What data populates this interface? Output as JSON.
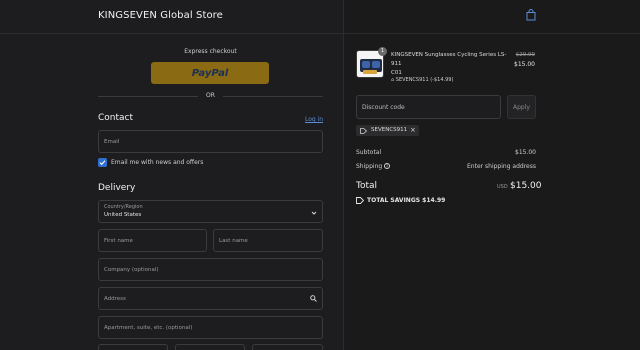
{
  "header": {
    "store_name": "KINGSEVEN Global Store",
    "cart_icon": "shopping-bag-icon"
  },
  "express": {
    "label": "Express checkout",
    "paypal_label": "PayPal",
    "or_label": "OR"
  },
  "contact": {
    "title": "Contact",
    "login_link": "Log in",
    "email_label": "Email",
    "newsletter_label": "Email me with news and offers",
    "newsletter_checked": true
  },
  "delivery": {
    "title": "Delivery",
    "country_label": "Country/Region",
    "country_value": "United States",
    "first_name_label": "First name",
    "last_name_label": "Last name",
    "company_label": "Company (optional)",
    "address_label": "Address",
    "apartment_label": "Apartment, suite, etc. (optional)"
  },
  "order": {
    "item": {
      "title": "KINGSEVEN Sunglasses Cycling Series LS-911",
      "variant": "C01",
      "quantity": "1",
      "discount_tag": "SEVENCS911 (-$14.99)",
      "price_original": "$29.99",
      "price_current": "$15.00"
    },
    "discount_placeholder": "Discount code",
    "apply_label": "Apply",
    "applied_code": "SEVENCS911",
    "subtotal_label": "Subtotal",
    "subtotal_value": "$15.00",
    "shipping_label": "Shipping",
    "shipping_value": "Enter shipping address",
    "total_label": "Total",
    "total_currency": "USD",
    "total_value": "$15.00",
    "savings_label": "TOTAL SAVINGS $14.99"
  },
  "colors": {
    "accent": "#2f6fd1",
    "paypal": "#8a6a12",
    "link": "#5b8cd6"
  }
}
